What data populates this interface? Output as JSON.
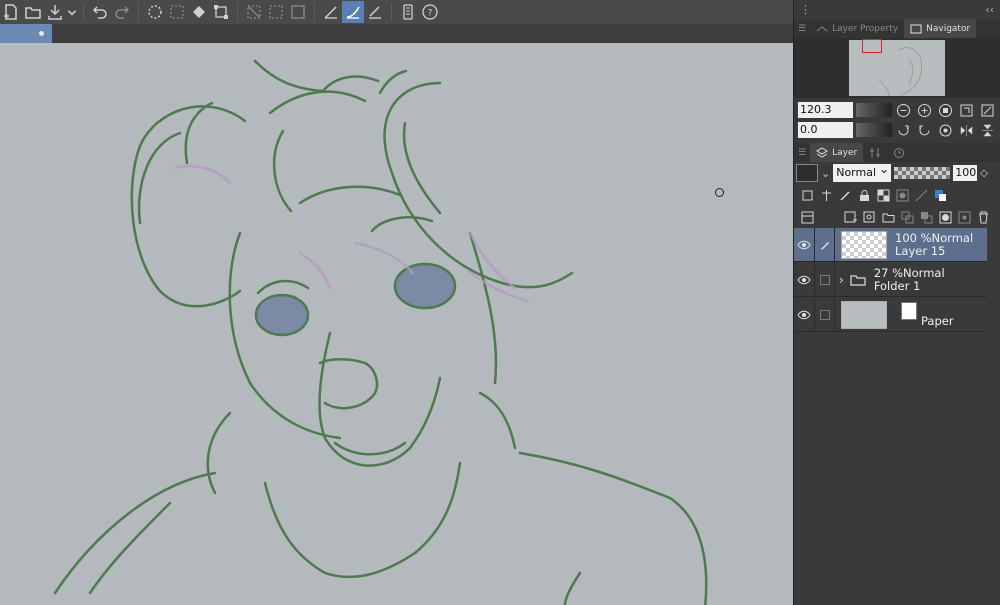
{
  "toolbar": {
    "icons": [
      "new-file",
      "open-folder",
      "save-download",
      "dropdown",
      "undo",
      "redo",
      "clear-selection",
      "invert-selection",
      "fill",
      "transform",
      "hide-selection",
      "deselect",
      "crop",
      "line-correct",
      "stabilize-curve",
      "ruler-pen",
      "smartphone-companion",
      "help"
    ],
    "active_index": 15
  },
  "canvas": {
    "background": "#b4b9bd",
    "line_color": "#4d7a4f",
    "accent_purple": "#b79ac4",
    "eye_fill": "#7d8aa5"
  },
  "panel": {
    "collapse_label": "‹‹",
    "tabs": [
      {
        "label": "Layer Property",
        "active": false
      },
      {
        "label": "Navigator",
        "active": true
      }
    ],
    "navigator": {
      "zoom": "120.3",
      "rotation": "0.0"
    },
    "layer_tabs": [
      {
        "label": "Layer",
        "active": true
      }
    ],
    "blend_mode": "Normal",
    "opacity": "100",
    "layers": [
      {
        "opacity_mode": "100 %Normal",
        "name": "Layer 15",
        "selected": true,
        "kind": "raster"
      },
      {
        "opacity_mode": "27 %Normal",
        "name": "Folder 1",
        "selected": false,
        "kind": "folder"
      },
      {
        "opacity_mode": "",
        "name": "Paper",
        "selected": false,
        "kind": "paper"
      }
    ]
  }
}
